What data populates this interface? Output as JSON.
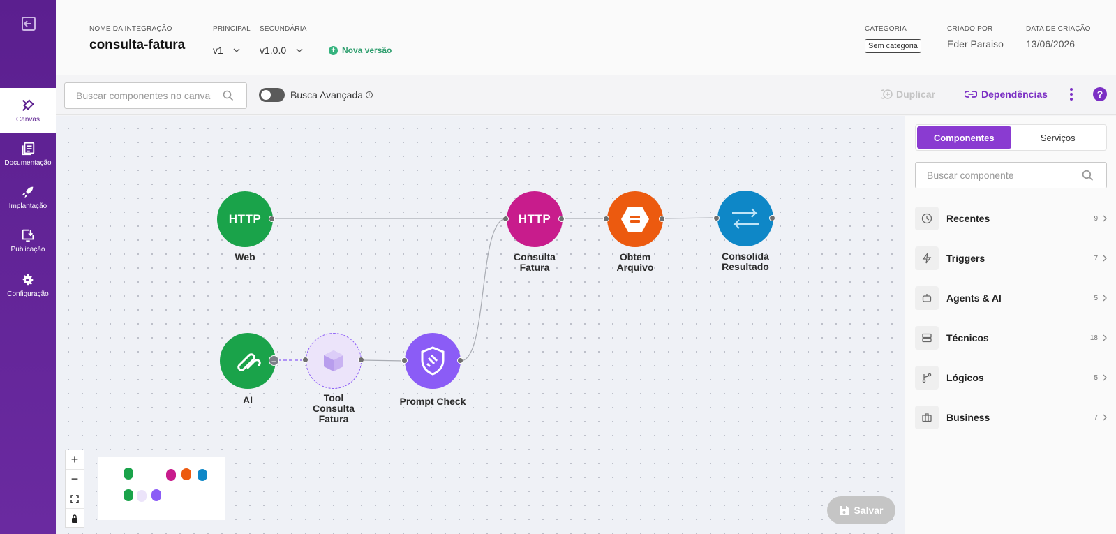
{
  "header": {
    "nome_label": "NOME DA INTEGRAÇÃO",
    "nome_value": "consulta-fatura",
    "principal_label": "PRINCIPAL",
    "principal_value": "v1",
    "secundaria_label": "SECUNDÁRIA",
    "secundaria_value": "v1.0.0",
    "nova_versao": "Nova versão",
    "categoria_label": "CATEGORIA",
    "categoria_value": "Sem categoria",
    "criado_label": "CRIADO POR",
    "criado_value": "Eder Paraiso",
    "data_label": "DATA DE CRIAÇÃO",
    "data_value": "13/06/2026"
  },
  "sidebar": {
    "items": [
      {
        "label": "Canvas",
        "icon": "canvas-icon"
      },
      {
        "label": "Documentação",
        "icon": "documentation-icon"
      },
      {
        "label": "Implantação",
        "icon": "rocket-icon"
      },
      {
        "label": "Publicação",
        "icon": "publish-icon"
      },
      {
        "label": "Configuração",
        "icon": "gear-icon"
      }
    ]
  },
  "toolbar": {
    "search_placeholder": "Buscar componentes no canvas",
    "busca_avancada": "Busca Avançada",
    "duplicar": "Duplicar",
    "dependencias": "Dependências"
  },
  "canvas": {
    "nodes": [
      {
        "id": "web",
        "label": "Web",
        "icon_text": "HTTP",
        "color": "#1aa34a"
      },
      {
        "id": "consulta-fatura",
        "label": "Consulta Fatura",
        "icon_text": "HTTP",
        "color": "#c81c8c"
      },
      {
        "id": "obtem-arquivo",
        "label": "Obtem Arquivo",
        "color": "#ec5a0f"
      },
      {
        "id": "consolida-resultado",
        "label": "Consolida Resultado",
        "color": "#0e87c7"
      },
      {
        "id": "ai",
        "label": "AI",
        "color": "#1aa34a"
      },
      {
        "id": "tool-consulta-fatura",
        "label": "Tool Consulta Fatura",
        "color": "#ece4fa"
      },
      {
        "id": "prompt-check",
        "label": "Prompt Check",
        "color": "#8b5cf6"
      }
    ],
    "save": "Salvar"
  },
  "panel": {
    "tabs": [
      "Componentes",
      "Serviços"
    ],
    "search_placeholder": "Buscar componente",
    "categories": [
      {
        "name": "Recentes",
        "count": "9",
        "icon": "clock-icon"
      },
      {
        "name": "Triggers",
        "count": "7",
        "icon": "lightning-icon"
      },
      {
        "name": "Agents & AI",
        "count": "5",
        "icon": "robot-icon"
      },
      {
        "name": "Técnicos",
        "count": "18",
        "icon": "server-icon"
      },
      {
        "name": "Lógicos",
        "count": "5",
        "icon": "branch-icon"
      },
      {
        "name": "Business",
        "count": "7",
        "icon": "briefcase-icon"
      }
    ]
  }
}
